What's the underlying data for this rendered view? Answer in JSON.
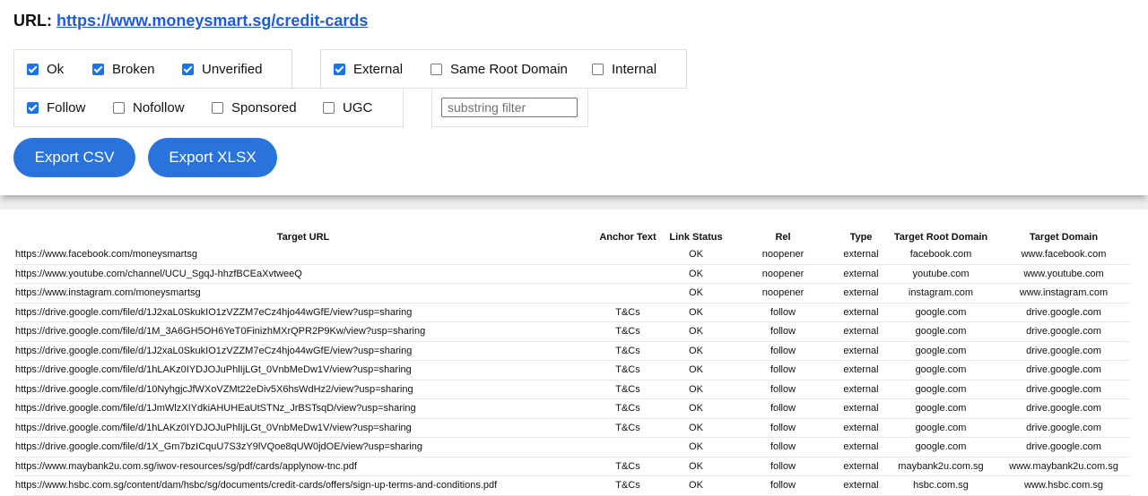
{
  "header": {
    "url_label": "URL:",
    "url": "https://www.moneysmart.sg/credit-cards"
  },
  "filters": {
    "status": [
      {
        "label": "Ok",
        "checked": true
      },
      {
        "label": "Broken",
        "checked": true
      },
      {
        "label": "Unverified",
        "checked": true
      }
    ],
    "scope": [
      {
        "label": "External",
        "checked": true
      },
      {
        "label": "Same Root Domain",
        "checked": false
      },
      {
        "label": "Internal",
        "checked": false
      }
    ],
    "rel": [
      {
        "label": "Follow",
        "checked": true
      },
      {
        "label": "Nofollow",
        "checked": false
      },
      {
        "label": "Sponsored",
        "checked": false
      },
      {
        "label": "UGC",
        "checked": false
      }
    ],
    "substring_placeholder": "substring filter",
    "substring_value": ""
  },
  "buttons": {
    "export_csv": "Export CSV",
    "export_xlsx": "Export XLSX"
  },
  "table": {
    "columns": [
      "Target URL",
      "Anchor Text",
      "Link Status",
      "Rel",
      "Type",
      "Target Root Domain",
      "Target Domain"
    ],
    "rows": [
      [
        "https://www.facebook.com/moneysmartsg",
        "",
        "OK",
        "noopener",
        "external",
        "facebook.com",
        "www.facebook.com"
      ],
      [
        "https://www.youtube.com/channel/UCU_SgqJ-hhzfBCEaXvtweeQ",
        "",
        "OK",
        "noopener",
        "external",
        "youtube.com",
        "www.youtube.com"
      ],
      [
        "https://www.instagram.com/moneysmartsg",
        "",
        "OK",
        "noopener",
        "external",
        "instagram.com",
        "www.instagram.com"
      ],
      [
        "https://drive.google.com/file/d/1J2xaL0SkukIO1zVZZM7eCz4hjo44wGfE/view?usp=sharing",
        "T&Cs",
        "OK",
        "follow",
        "external",
        "google.com",
        "drive.google.com"
      ],
      [
        "https://drive.google.com/file/d/1M_3A6GH5OH6YeT0FinizhMXrQPR2P9Kw/view?usp=sharing",
        "T&Cs",
        "OK",
        "follow",
        "external",
        "google.com",
        "drive.google.com"
      ],
      [
        "https://drive.google.com/file/d/1J2xaL0SkukIO1zVZZM7eCz4hjo44wGfE/view?usp=sharing",
        "T&Cs",
        "OK",
        "follow",
        "external",
        "google.com",
        "drive.google.com"
      ],
      [
        "https://drive.google.com/file/d/1hLAKz0IYDJOJuPhlIjLGt_0VnbMeDw1V/view?usp=sharing",
        "T&Cs",
        "OK",
        "follow",
        "external",
        "google.com",
        "drive.google.com"
      ],
      [
        "https://drive.google.com/file/d/10NyhgjcJfWXoVZMt22eDiv5X6hsWdHz2/view?usp=sharing",
        "T&Cs",
        "OK",
        "follow",
        "external",
        "google.com",
        "drive.google.com"
      ],
      [
        "https://drive.google.com/file/d/1JmWlzXIYdkiAHUHEaUtSTNz_JrBSTsqD/view?usp=sharing",
        "T&Cs",
        "OK",
        "follow",
        "external",
        "google.com",
        "drive.google.com"
      ],
      [
        "https://drive.google.com/file/d/1hLAKz0IYDJOJuPhlIjLGt_0VnbMeDw1V/view?usp=sharing",
        "T&Cs",
        "OK",
        "follow",
        "external",
        "google.com",
        "drive.google.com"
      ],
      [
        "https://drive.google.com/file/d/1X_Gm7bzICquU7S3zY9lVQoe8qUW0jdOE/view?usp=sharing",
        "",
        "OK",
        "follow",
        "external",
        "google.com",
        "drive.google.com"
      ],
      [
        "https://www.maybank2u.com.sg/iwov-resources/sg/pdf/cards/applynow-tnc.pdf",
        "T&Cs",
        "OK",
        "follow",
        "external",
        "maybank2u.com.sg",
        "www.maybank2u.com.sg"
      ],
      [
        "https://www.hsbc.com.sg/content/dam/hsbc/sg/documents/credit-cards/offers/sign-up-terms-and-conditions.pdf",
        "T&Cs",
        "OK",
        "follow",
        "external",
        "hsbc.com.sg",
        "www.hsbc.com.sg"
      ]
    ]
  },
  "colors": {
    "accent": "#2a73dd",
    "link": "#1a5ed8",
    "checkbox": "#1a73e8"
  }
}
